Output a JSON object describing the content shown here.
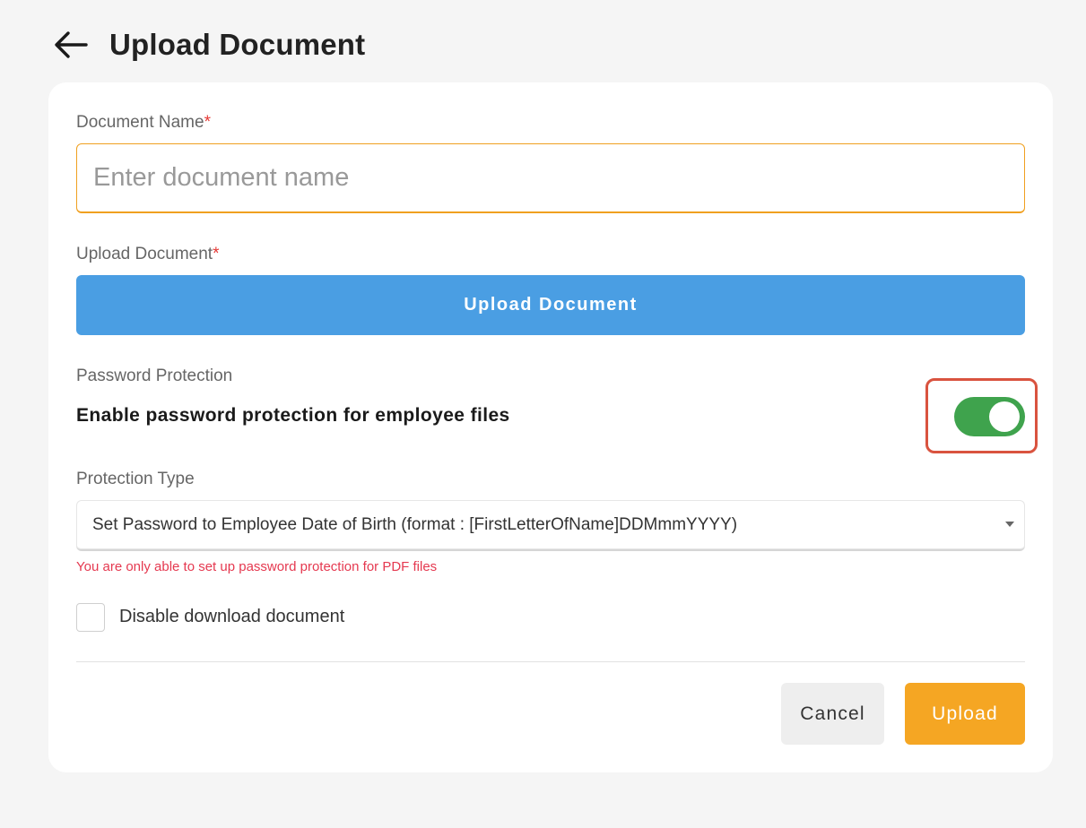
{
  "header": {
    "title": "Upload Document",
    "back_icon": "arrow-left-icon"
  },
  "form": {
    "document_name": {
      "label": "Document Name",
      "required_mark": "*",
      "value": "",
      "placeholder": "Enter document name"
    },
    "upload_document": {
      "label": "Upload Document",
      "required_mark": "*",
      "button_label": "Upload Document"
    },
    "password_protection": {
      "label": "Password Protection",
      "description": "Enable password protection for employee files",
      "enabled": true
    },
    "protection_type": {
      "label": "Protection Type",
      "selected": "Set Password to Employee Date of Birth (format : [FirstLetterOfName]DDMmmYYYY)",
      "warning": "You are only able to set up password protection for PDF files"
    },
    "disable_download": {
      "label": "Disable download document",
      "checked": false
    }
  },
  "actions": {
    "cancel_label": "Cancel",
    "submit_label": "Upload"
  },
  "colors": {
    "accent_orange": "#f5a623",
    "upload_blue": "#4a9ee3",
    "toggle_green": "#3fa34d",
    "error_red": "#e53950",
    "highlight_red": "#d9533f"
  }
}
